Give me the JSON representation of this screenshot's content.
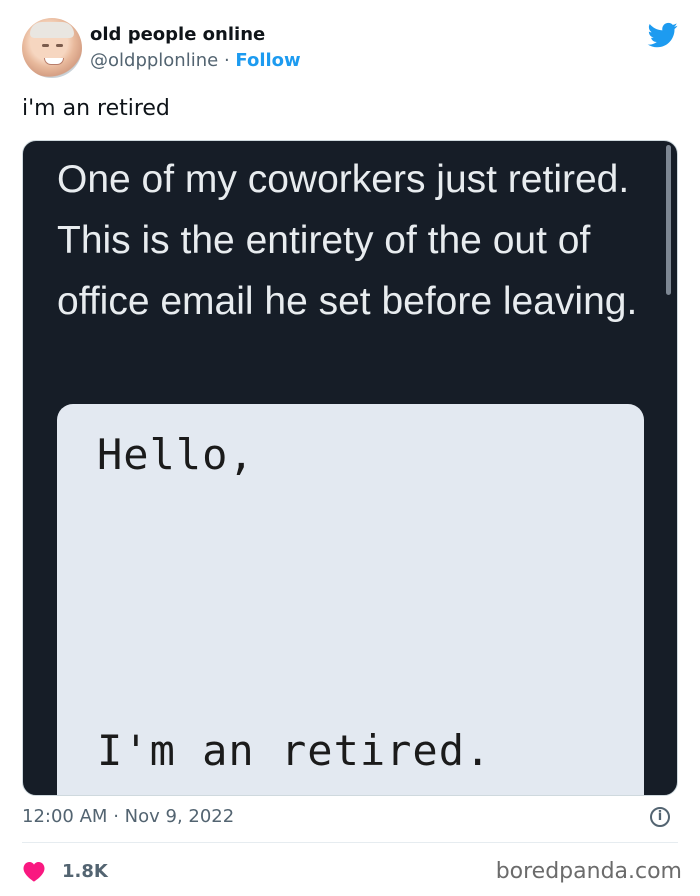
{
  "author": {
    "name": "old people online",
    "handle": "@oldpplonline",
    "separator": "·",
    "follow_label": "Follow"
  },
  "tweet": {
    "text": "i'm an retired",
    "media_caption": "One of my coworkers just retired. This is the entirety of the out of office email he set before leaving.",
    "email_greeting": "Hello,",
    "email_body": "I'm an retired.",
    "time": "12:00 AM",
    "date_separator": "·",
    "date": "Nov 9, 2022",
    "likes": "1.8K"
  },
  "icons": {
    "brand": "twitter-bird-icon",
    "info": "info-icon",
    "like": "heart-icon"
  },
  "colors": {
    "accent": "#1d9bf0",
    "heart": "#f91880",
    "media_bg": "#161d27"
  },
  "watermark": "boredpanda.com"
}
